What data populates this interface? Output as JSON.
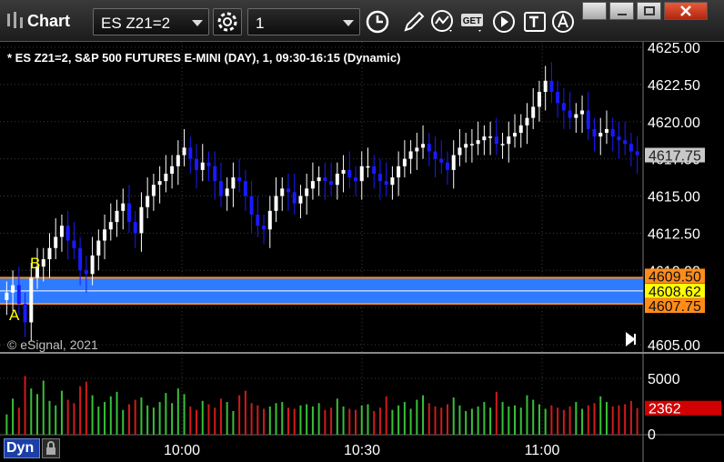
{
  "window": {
    "app_label": "Chart",
    "symbol_value": "ES Z21=2",
    "interval_value": "1",
    "get_label": "GET",
    "buttons": [
      "settings-icon",
      "clock-icon",
      "pencil-icon",
      "study-icon",
      "get-data-icon",
      "play-icon",
      "text-icon",
      "alert-icon"
    ]
  },
  "chart": {
    "header": "* ES Z21=2, S&P 500 FUTURES E-MINI (DAY), 1, 09:30-16:15 (Dynamic)",
    "copyright": "© eSignal, 2021",
    "footer_mode": "Dyn",
    "label_a": "A",
    "label_b": "B",
    "price_ticks": [
      "4625.00",
      "4622.50",
      "4620.00",
      "4617.50",
      "4615.00",
      "4612.50",
      "4610.00",
      "4607.50",
      "4605.00"
    ],
    "current_price": "4617.75",
    "band_high": "4609.50",
    "band_mid": "4608.62",
    "band_low": "4607.75",
    "volume_ticks": [
      "5000",
      "0"
    ],
    "current_volume": "2362",
    "time_ticks": [
      "10:00",
      "10:30",
      "11:00"
    ],
    "colors": {
      "up": "#ffffff",
      "down": "#1a1aff",
      "band": "#2f7bff",
      "band_border": "#ff8c1a",
      "vol_up": "#38c038",
      "vol_down": "#d21a1a",
      "price_tag": "#c8c8c8",
      "mid_tag": "#ffff00",
      "vol_tag": "#d20000"
    }
  },
  "chart_data": {
    "type": "candlestick",
    "title": "* ES Z21=2, S&P 500 FUTURES E-MINI (DAY), 1, 09:30-16:15 (Dynamic)",
    "ylim": [
      4605.0,
      4625.5
    ],
    "xlabels": [
      "10:00",
      "10:30",
      "11:00"
    ],
    "close_series": [
      4608.5,
      4609.0,
      4607.75,
      4606.5,
      4609.5,
      4610.25,
      4610.75,
      4611.5,
      4612.25,
      4613.0,
      4612.0,
      4611.5,
      4610.0,
      4609.75,
      4611.0,
      4612.0,
      4612.75,
      4613.25,
      4614.0,
      4614.5,
      4613.25,
      4612.5,
      4614.25,
      4615.0,
      4615.75,
      4616.0,
      4616.5,
      4617.0,
      4617.75,
      4618.25,
      4617.5,
      4616.75,
      4617.25,
      4617.0,
      4616.0,
      4615.0,
      4615.5,
      4616.25,
      4616.0,
      4615.0,
      4613.75,
      4613.0,
      4612.75,
      4614.0,
      4615.0,
      4615.5,
      4615.25,
      4614.5,
      4615.0,
      4615.5,
      4616.0,
      4616.25,
      4616.0,
      4615.75,
      4616.5,
      4616.75,
      4616.25,
      4616.0,
      4617.0,
      4617.0,
      4616.5,
      4616.0,
      4615.75,
      4616.25,
      4617.0,
      4617.5,
      4618.0,
      4618.25,
      4618.5,
      4618.0,
      4617.5,
      4617.25,
      4616.75,
      4617.75,
      4618.25,
      4618.5,
      4618.5,
      4618.75,
      4619.0,
      4619.0,
      4618.5,
      4618.5,
      4619.0,
      4619.25,
      4619.75,
      4620.25,
      4621.0,
      4622.0,
      4622.75,
      4622.0,
      4621.25,
      4620.75,
      4620.25,
      4620.5,
      4620.75,
      4619.5,
      4619.0,
      4619.25,
      4619.5,
      4619.0,
      4618.75,
      4618.5,
      4618.0,
      4617.75
    ],
    "volume_series": [
      1800,
      3200,
      2400,
      5200,
      4100,
      3600,
      4800,
      3000,
      2600,
      3900,
      3100,
      2800,
      4300,
      4700,
      3500,
      2500,
      2900,
      3400,
      3800,
      2200,
      2700,
      3100,
      3300,
      2600,
      2400,
      2900,
      3700,
      2800,
      4100,
      3600,
      2500,
      2200,
      3000,
      2700,
      2400,
      3200,
      2900,
      2100,
      3500,
      3900,
      2800,
      2600,
      2300,
      2500,
      2800,
      2900,
      2400,
      2300,
      2600,
      2700,
      2500,
      2800,
      2200,
      2400,
      3200,
      2500,
      2300,
      2200,
      2600,
      2700,
      2100,
      2400,
      3400,
      2200,
      2600,
      2900,
      2300,
      3100,
      3500,
      2800,
      2500,
      2400,
      2700,
      3300,
      2600,
      2100,
      2300,
      2500,
      2900,
      2400,
      3800,
      2900,
      2500,
      2600,
      2400,
      3500,
      3100,
      2700,
      2300,
      2600,
      2400,
      2200,
      2500,
      2900,
      2300,
      2600,
      2800,
      3400,
      2900,
      2500,
      2600,
      2700,
      3000,
      2362
    ],
    "levels": {
      "high": 4609.5,
      "mid": 4608.62,
      "low": 4607.75
    },
    "last": 4617.75,
    "last_volume": 2362
  }
}
